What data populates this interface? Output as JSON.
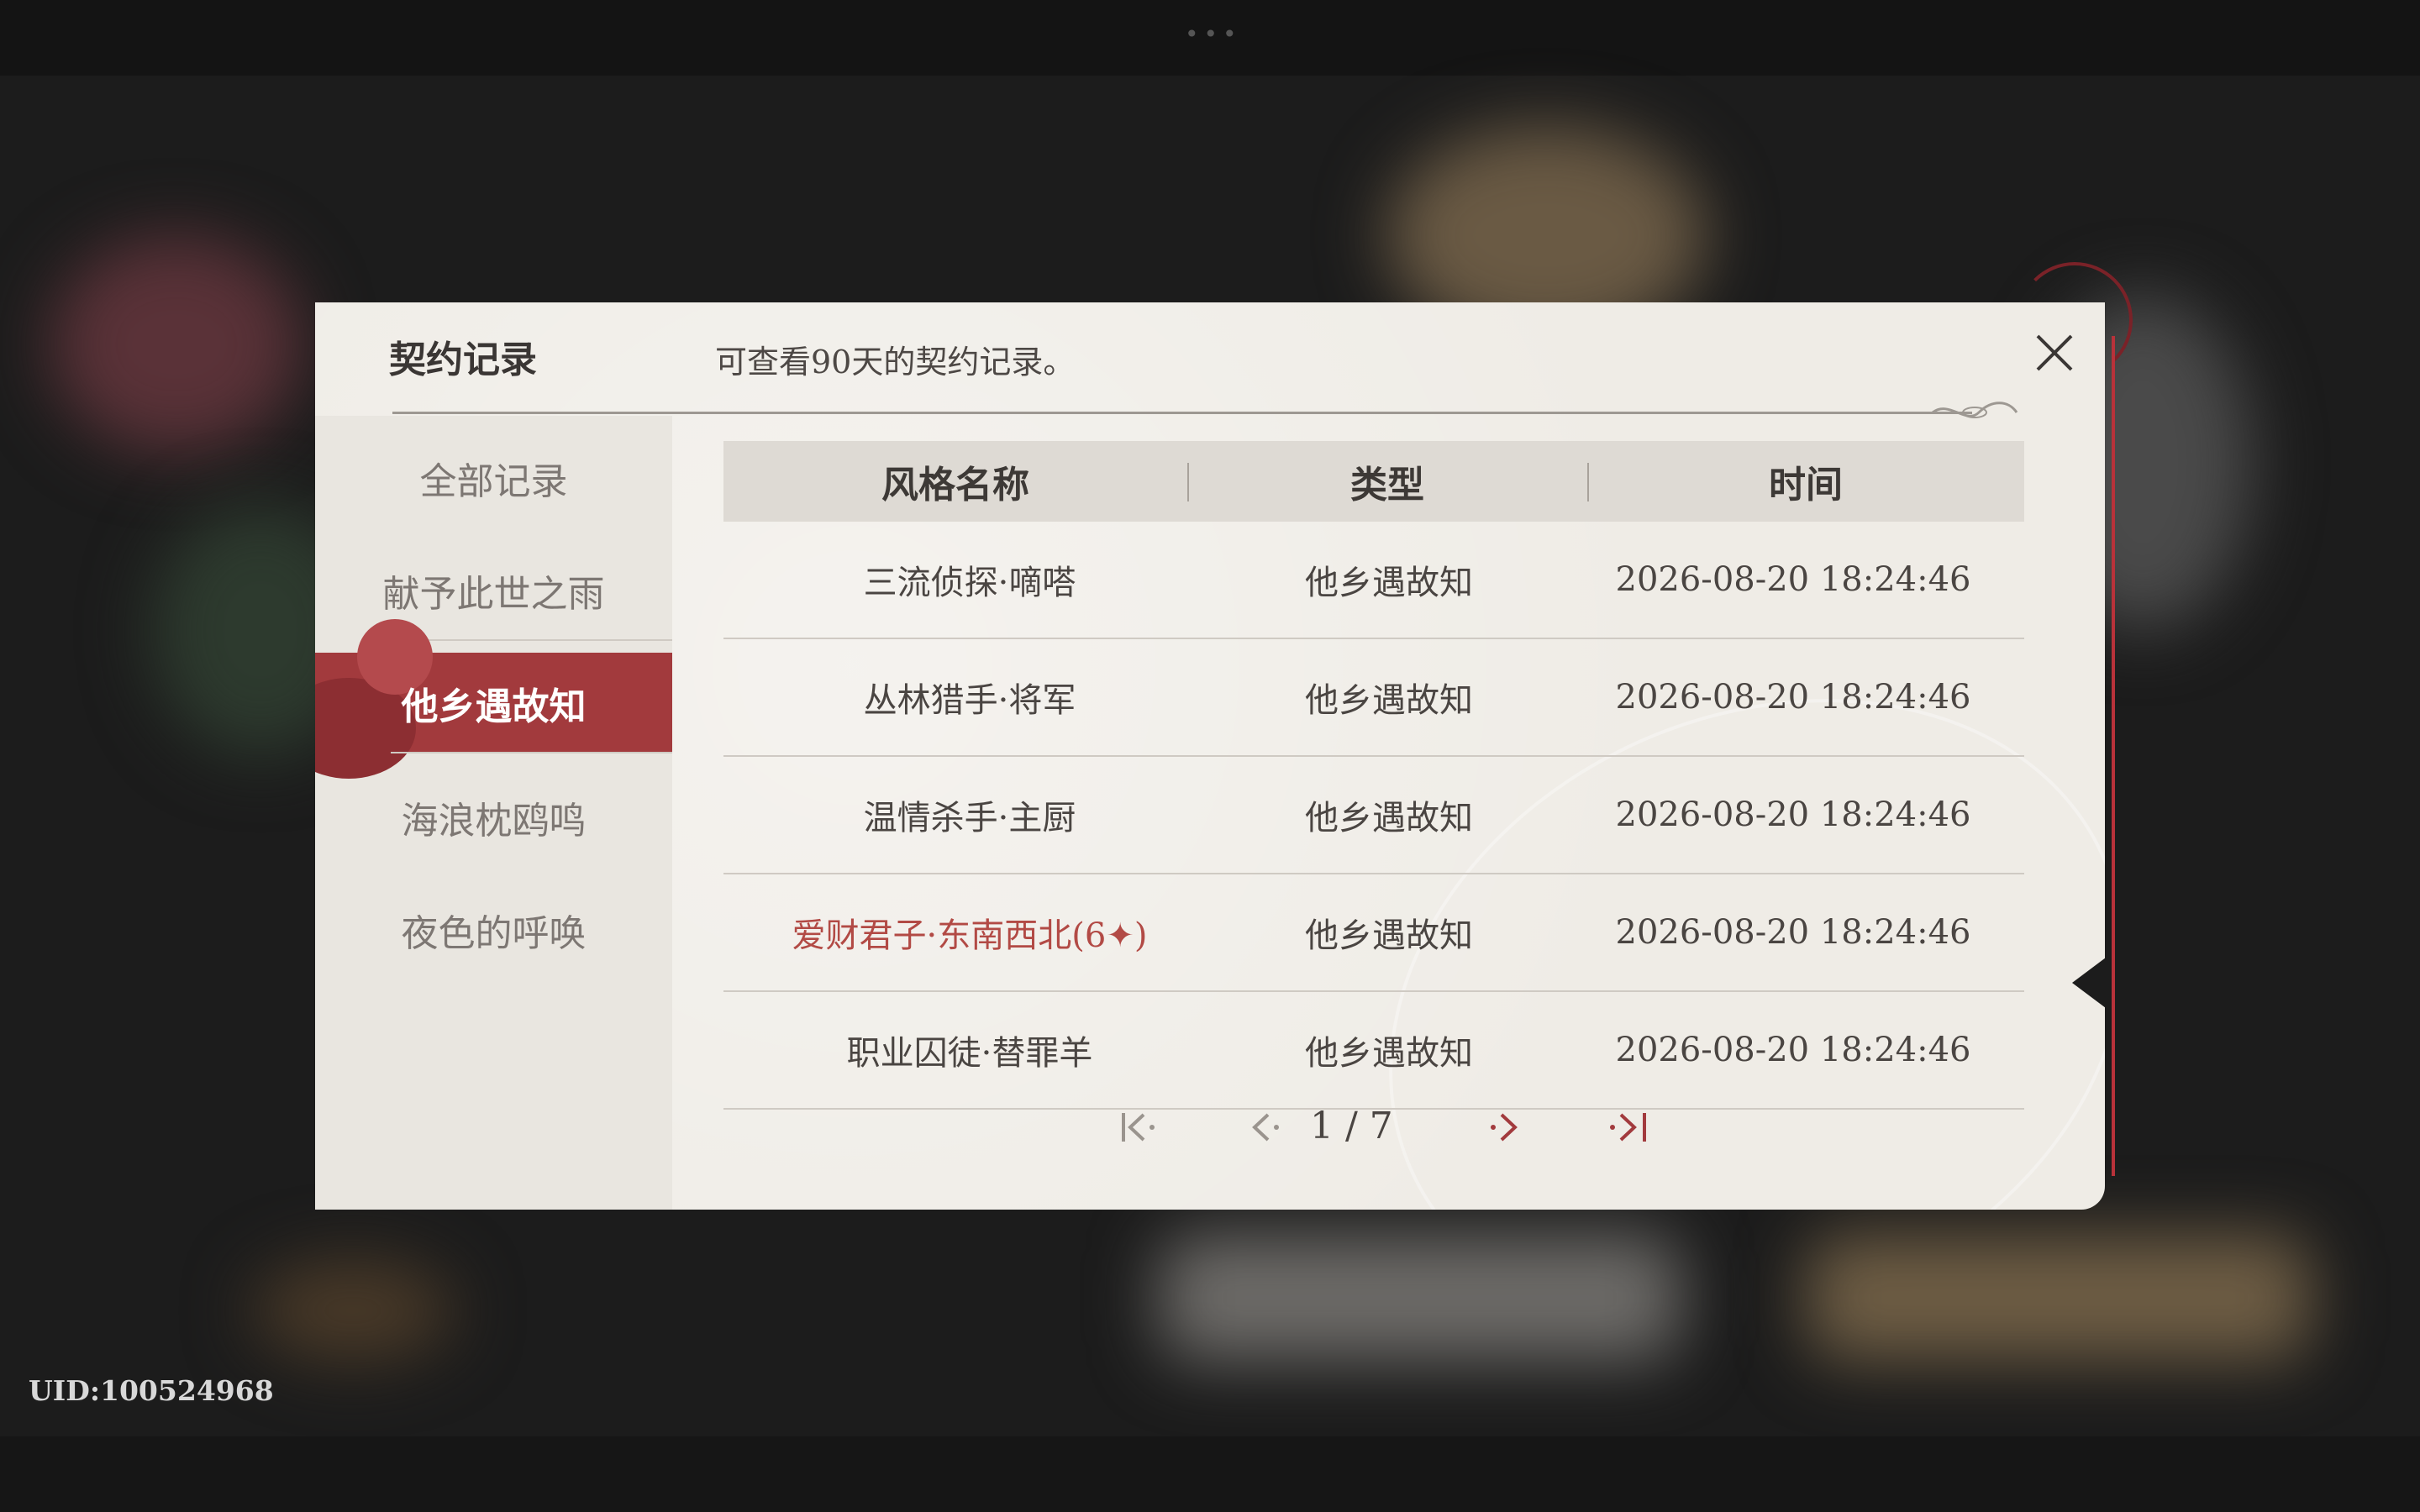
{
  "dialog": {
    "title": "契约记录",
    "subtitle": "可查看90天的契约记录。",
    "close_icon": "close-icon"
  },
  "sidebar": {
    "items": [
      {
        "label": "全部记录",
        "active": false
      },
      {
        "label": "献予此世之雨",
        "active": false
      },
      {
        "label": "他乡遇故知",
        "active": true
      },
      {
        "label": "海浪枕鸥鸣",
        "active": false
      },
      {
        "label": "夜色的呼唤",
        "active": false
      }
    ]
  },
  "table": {
    "headers": [
      "风格名称",
      "类型",
      "时间"
    ],
    "rows": [
      {
        "name": "三流侦探·嘀嗒",
        "type": "他乡遇故知",
        "time": "2026-08-20 18:24:46",
        "highlight": false
      },
      {
        "name": "丛林猎手·将军",
        "type": "他乡遇故知",
        "time": "2026-08-20 18:24:46",
        "highlight": false
      },
      {
        "name": "温情杀手·主厨",
        "type": "他乡遇故知",
        "time": "2026-08-20 18:24:46",
        "highlight": false
      },
      {
        "name": "爱财君子·东南西北(6✦)",
        "type": "他乡遇故知",
        "time": "2026-08-20 18:24:46",
        "highlight": true
      },
      {
        "name": "职业囚徒·替罪羊",
        "type": "他乡遇故知",
        "time": "2026-08-20 18:24:46",
        "highlight": false
      }
    ],
    "highlight_color": "#b24a45"
  },
  "pager": {
    "text": "1 / 7",
    "first_icon": "first-page-icon",
    "prev_icon": "prev-page-icon",
    "next_icon": "next-page-icon",
    "last_icon": "last-page-icon"
  },
  "footer": {
    "uid": "UID:100524968"
  },
  "colors": {
    "accent": "#a23a3d",
    "panel": "#efece6",
    "text": "#4a4542"
  }
}
